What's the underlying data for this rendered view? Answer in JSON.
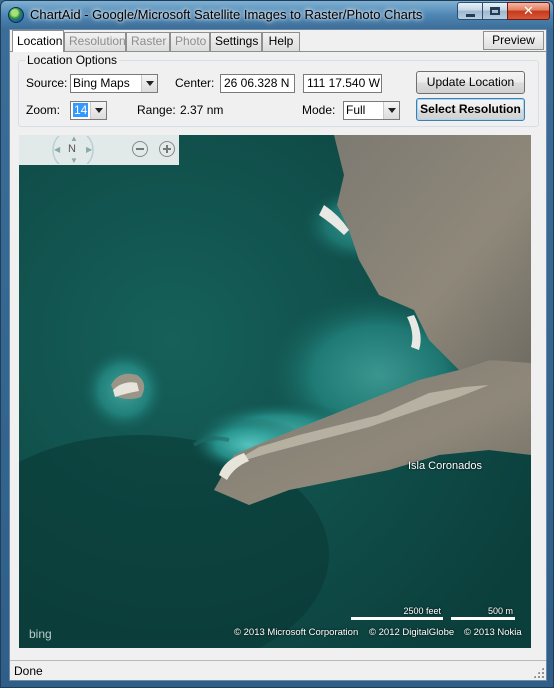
{
  "window": {
    "title": "ChartAid - Google/Microsoft Satellite Images to Raster/Photo Charts",
    "icon": "globe-icon"
  },
  "tabs": [
    {
      "label": "Location",
      "state": "active"
    },
    {
      "label": "Resolution",
      "state": "disabled"
    },
    {
      "label": "Raster",
      "state": "disabled"
    },
    {
      "label": "Photo",
      "state": "disabled"
    },
    {
      "label": "Settings",
      "state": "enabled"
    },
    {
      "label": "Help",
      "state": "enabled"
    }
  ],
  "preview_label": "Preview",
  "location_options": {
    "legend": "Location Options",
    "source_label": "Source:",
    "source_value": "Bing Maps",
    "center_label": "Center:",
    "center_lat": "26 06.328 N",
    "center_lon": "111 17.540 W",
    "update_button": "Update Location",
    "zoom_label": "Zoom:",
    "zoom_value": "14",
    "range_label": "Range:",
    "range_value": "2.37 nm",
    "mode_label": "Mode:",
    "mode_value": "Full",
    "select_resolution_button": "Select Resolution"
  },
  "map": {
    "compass_label": "N",
    "place_label": "Isla Coronados",
    "bing_logo": "bing",
    "copyright_microsoft": "© 2013 Microsoft Corporation",
    "copyright_digitalglobe": "© 2012 DigitalGlobe",
    "copyright_nokia": "© 2013 Nokia",
    "scale_feet": "2500 feet",
    "scale_meters": "500 m"
  },
  "status": {
    "text": "Done"
  },
  "colors": {
    "water_deep": "#0e4a46",
    "water_shallow": "#3fb3b0",
    "land": "#8a8478"
  }
}
